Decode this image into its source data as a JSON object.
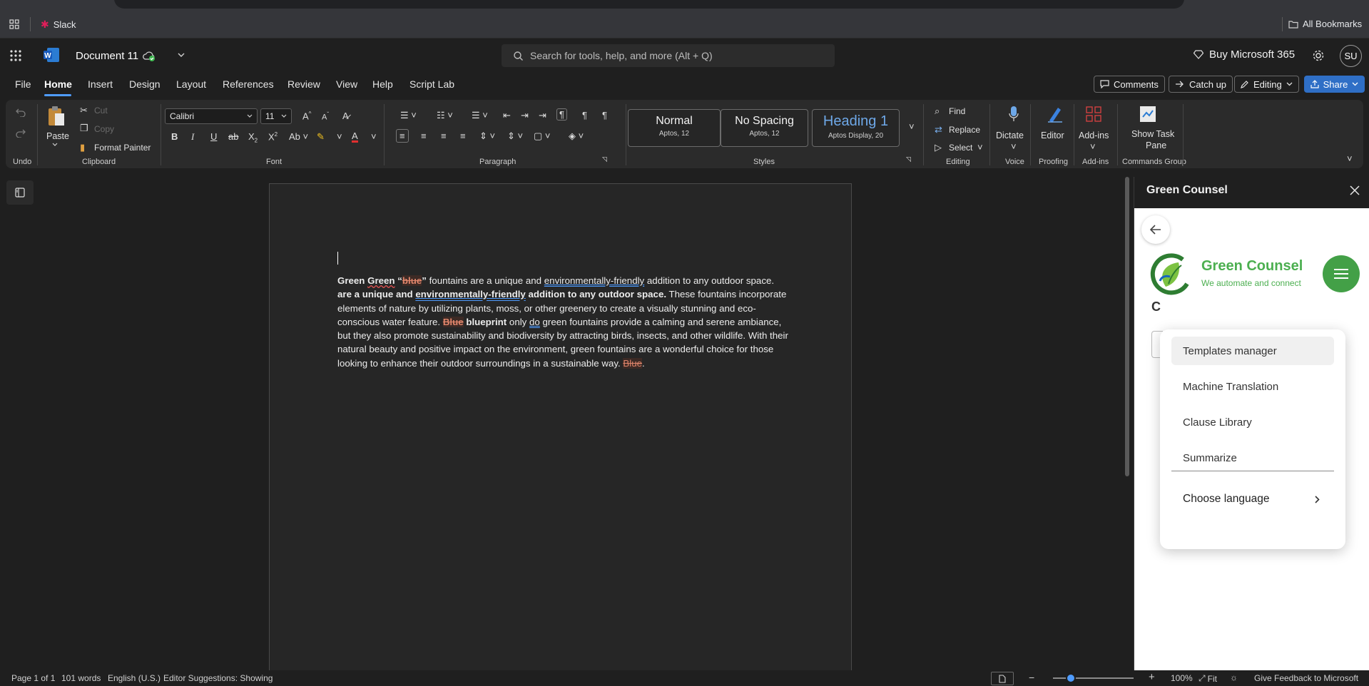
{
  "browser": {
    "bookmark_slack": "Slack",
    "all_bookmarks": "All Bookmarks"
  },
  "titlebar": {
    "doc_title": "Document 11",
    "search_placeholder": "Search for tools, help, and more (Alt + Q)",
    "buy_label": "Buy Microsoft 365",
    "avatar_initials": "SU"
  },
  "tabs": [
    "File",
    "Home",
    "Insert",
    "Design",
    "Layout",
    "References",
    "Review",
    "View",
    "Help",
    "Script Lab"
  ],
  "top_actions": {
    "comments": "Comments",
    "catch_up": "Catch up",
    "editing": "Editing",
    "share": "Share"
  },
  "ribbon": {
    "undo_group": "Undo",
    "clipboard": {
      "paste": "Paste",
      "cut": "Cut",
      "copy": "Copy",
      "format_painter": "Format Painter",
      "group": "Clipboard"
    },
    "font": {
      "family": "Calibri",
      "size": "11",
      "group": "Font"
    },
    "paragraph_group": "Paragraph",
    "styles": {
      "items": [
        {
          "name": "Normal",
          "sub": "Aptos, 12"
        },
        {
          "name": "No Spacing",
          "sub": "Aptos, 12"
        },
        {
          "name": "Heading 1",
          "sub": "Aptos Display, 20"
        }
      ],
      "group": "Styles"
    },
    "editing": {
      "find": "Find",
      "replace": "Replace",
      "select": "Select",
      "group": "Editing"
    },
    "voice": {
      "dictate": "Dictate",
      "group": "Voice"
    },
    "proofing": {
      "editor": "Editor",
      "group": "Proofing"
    },
    "addins": {
      "addins": "Add-ins",
      "group": "Add-ins"
    },
    "commands": {
      "show_task_pane_1": "Show Task",
      "show_task_pane_2": "Pane",
      "group": "Commands Group"
    }
  },
  "document": {
    "runs": {
      "r1": "Green ",
      "r2": "Green",
      "r3": " “",
      "r4": "blue",
      "r5": "”",
      "r6": " fountains are a unique and ",
      "r7": "environmentally-friendly",
      "r8": " addition to any outdoor space. ",
      "r9": "are a unique and ",
      "r10": "environmentally-friendly",
      "r11": " addition to any outdoor space.",
      "r12": " These fountains incorporate elements of nature by utilizing plants, moss, or other greenery to create a visually stunning and eco-conscious water feature. ",
      "r13": "Blue",
      "r14": " blueprint",
      "r15": " only ",
      "r16": "do",
      "r17": " green fountains provide a calming and serene ambiance, but they also promote sustainability and biodiversity by attracting birds, insects, and other wildlife. With their natural beauty and positive impact on the environment, green fountains are a wonderful choice for those looking to enhance their outdoor surroundings in a sustainable way. ",
      "r18": "Blue",
      "r19": "."
    }
  },
  "pane": {
    "title": "Green Counsel",
    "brand_name": "Green Counsel",
    "brand_tagline": "We automate and connect",
    "menu": [
      "Templates manager",
      "Machine Translation",
      "Clause Library",
      "Summarize"
    ],
    "choose_language": "Choose language"
  },
  "status": {
    "page": "Page 1 of 1",
    "words": "101 words",
    "language": "English (U.S.)",
    "editor": "Editor Suggestions: Showing",
    "zoom": "100%",
    "fit": "Fit",
    "feedback": "Give Feedback to Microsoft"
  },
  "colors": {
    "accent_blue": "#2f6fc6",
    "brand_green": "#4caf50",
    "revision_red": "#e0856b"
  }
}
